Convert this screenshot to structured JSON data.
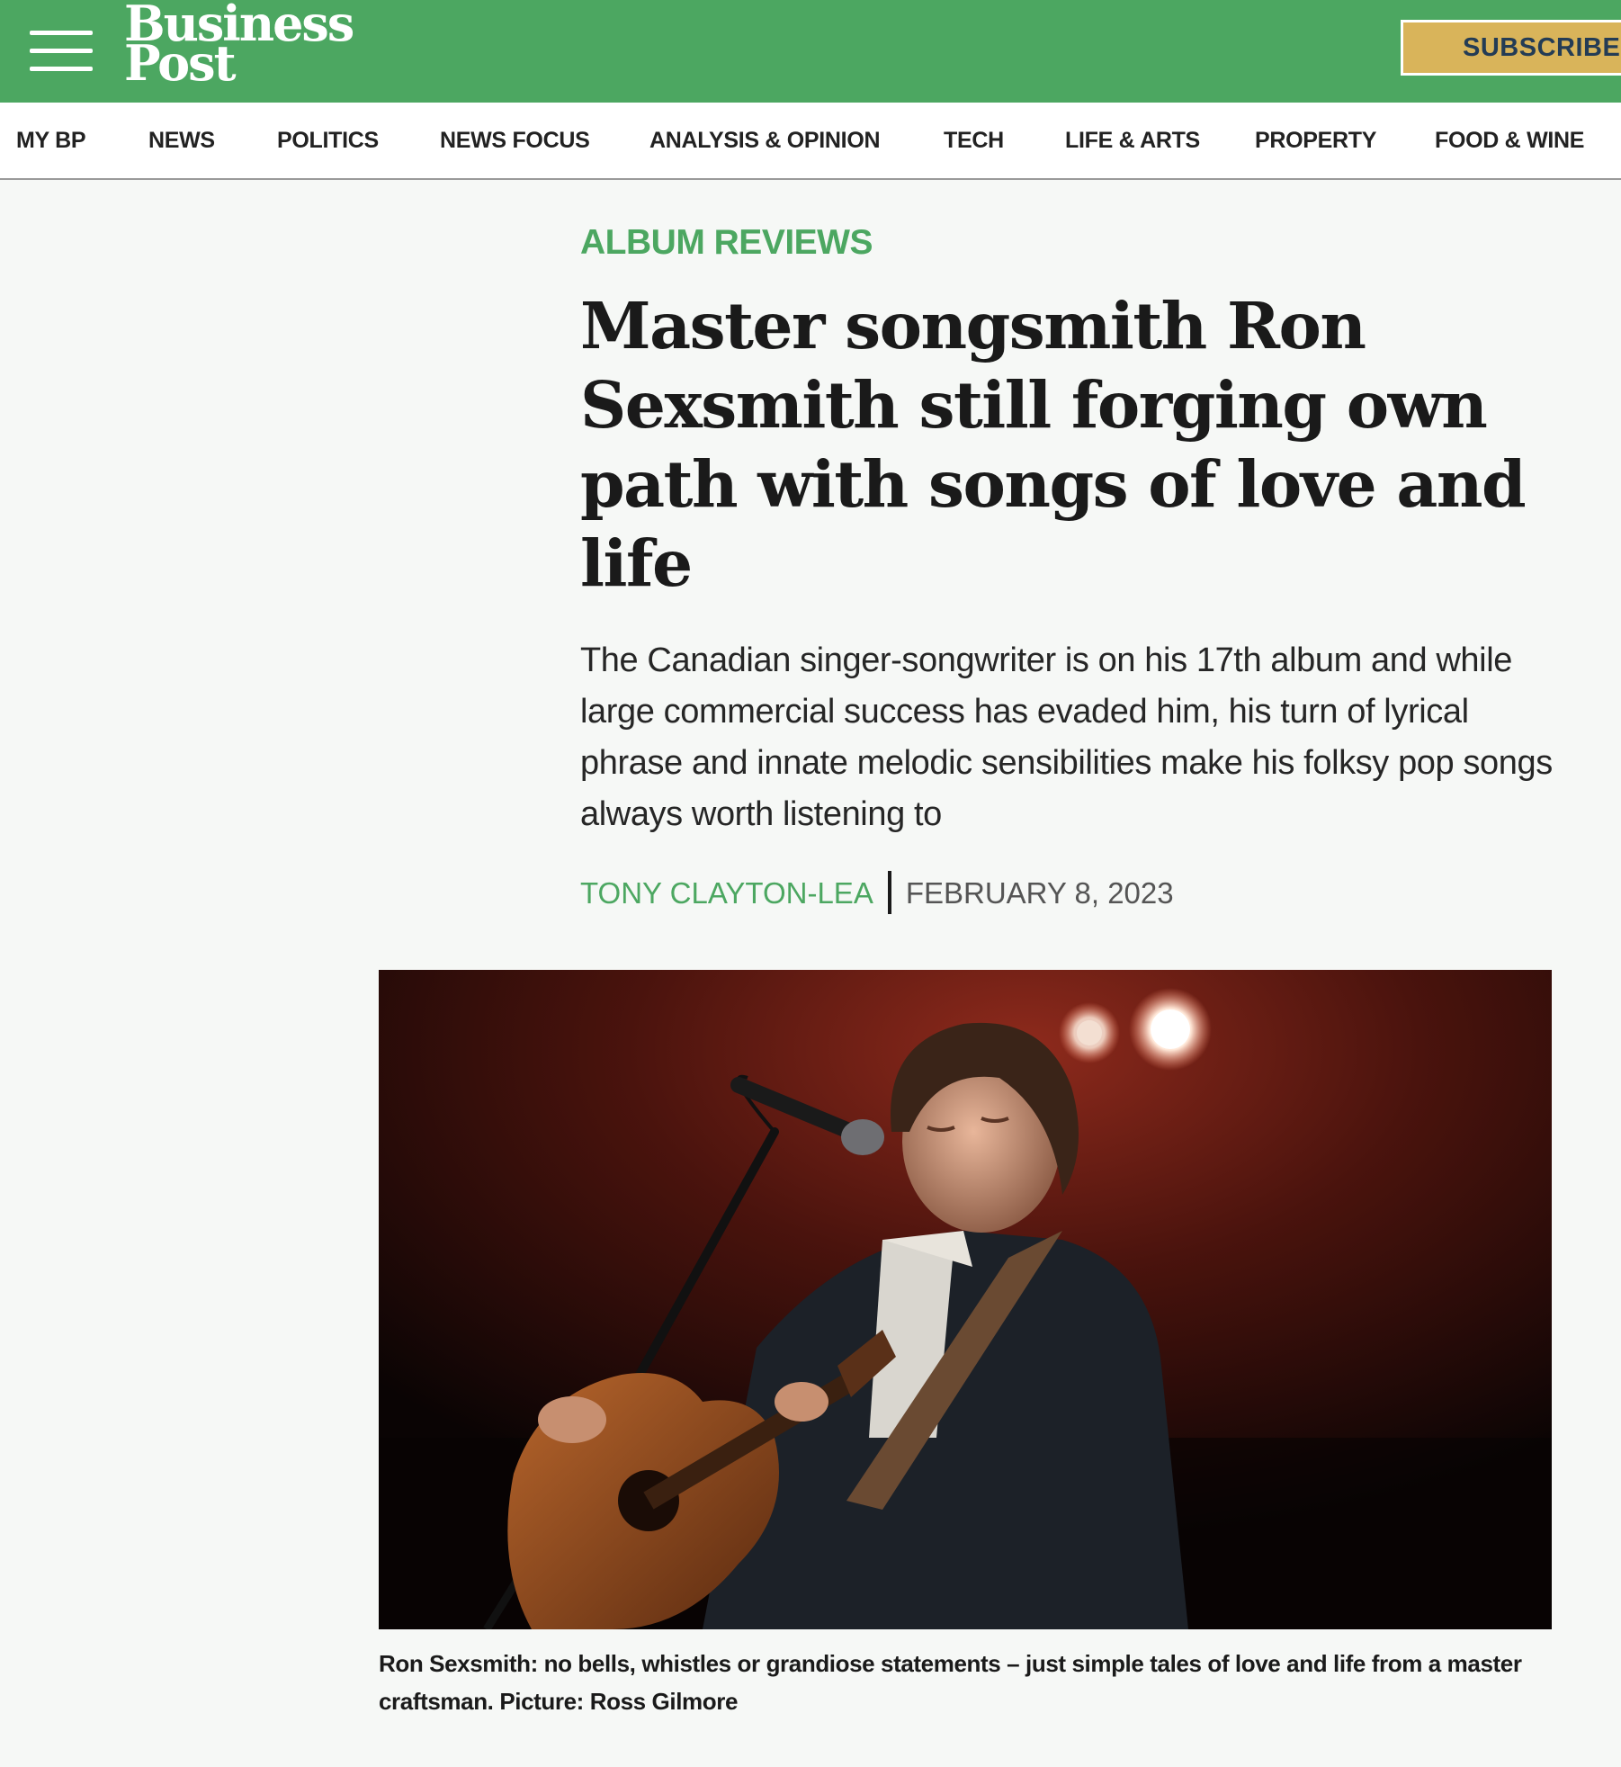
{
  "header": {
    "logo_line1": "Business",
    "logo_line2": "Post",
    "subscribe_label": "SUBSCRIBE",
    "brand_color": "#4ca761",
    "subscribe_color": "#d9b45a"
  },
  "nav": {
    "items": [
      {
        "label": "MY BP"
      },
      {
        "label": "NEWS"
      },
      {
        "label": "POLITICS"
      },
      {
        "label": "NEWS FOCUS"
      },
      {
        "label": "ANALYSIS & OPINION"
      },
      {
        "label": "TECH"
      },
      {
        "label": "LIFE & ARTS"
      },
      {
        "label": "PROPERTY"
      },
      {
        "label": "FOOD & WINE"
      }
    ]
  },
  "article": {
    "section": "ALBUM REVIEWS",
    "headline": "Master songsmith Ron Sexsmith still forging own path with songs of love and life",
    "standfirst": "The Canadian singer-songwriter is on his 17th album and while large commercial success has evaded him, his turn of lyrical phrase and innate melodic sensibilities make his folksy pop songs always worth listening to",
    "author": "TONY CLAYTON-LEA",
    "date": "FEBRUARY 8, 2023",
    "image_caption": "Ron Sexsmith: no bells, whistles or grandiose statements – just simple tales of love and life from a master craftsman. Picture: Ross Gilmore"
  }
}
